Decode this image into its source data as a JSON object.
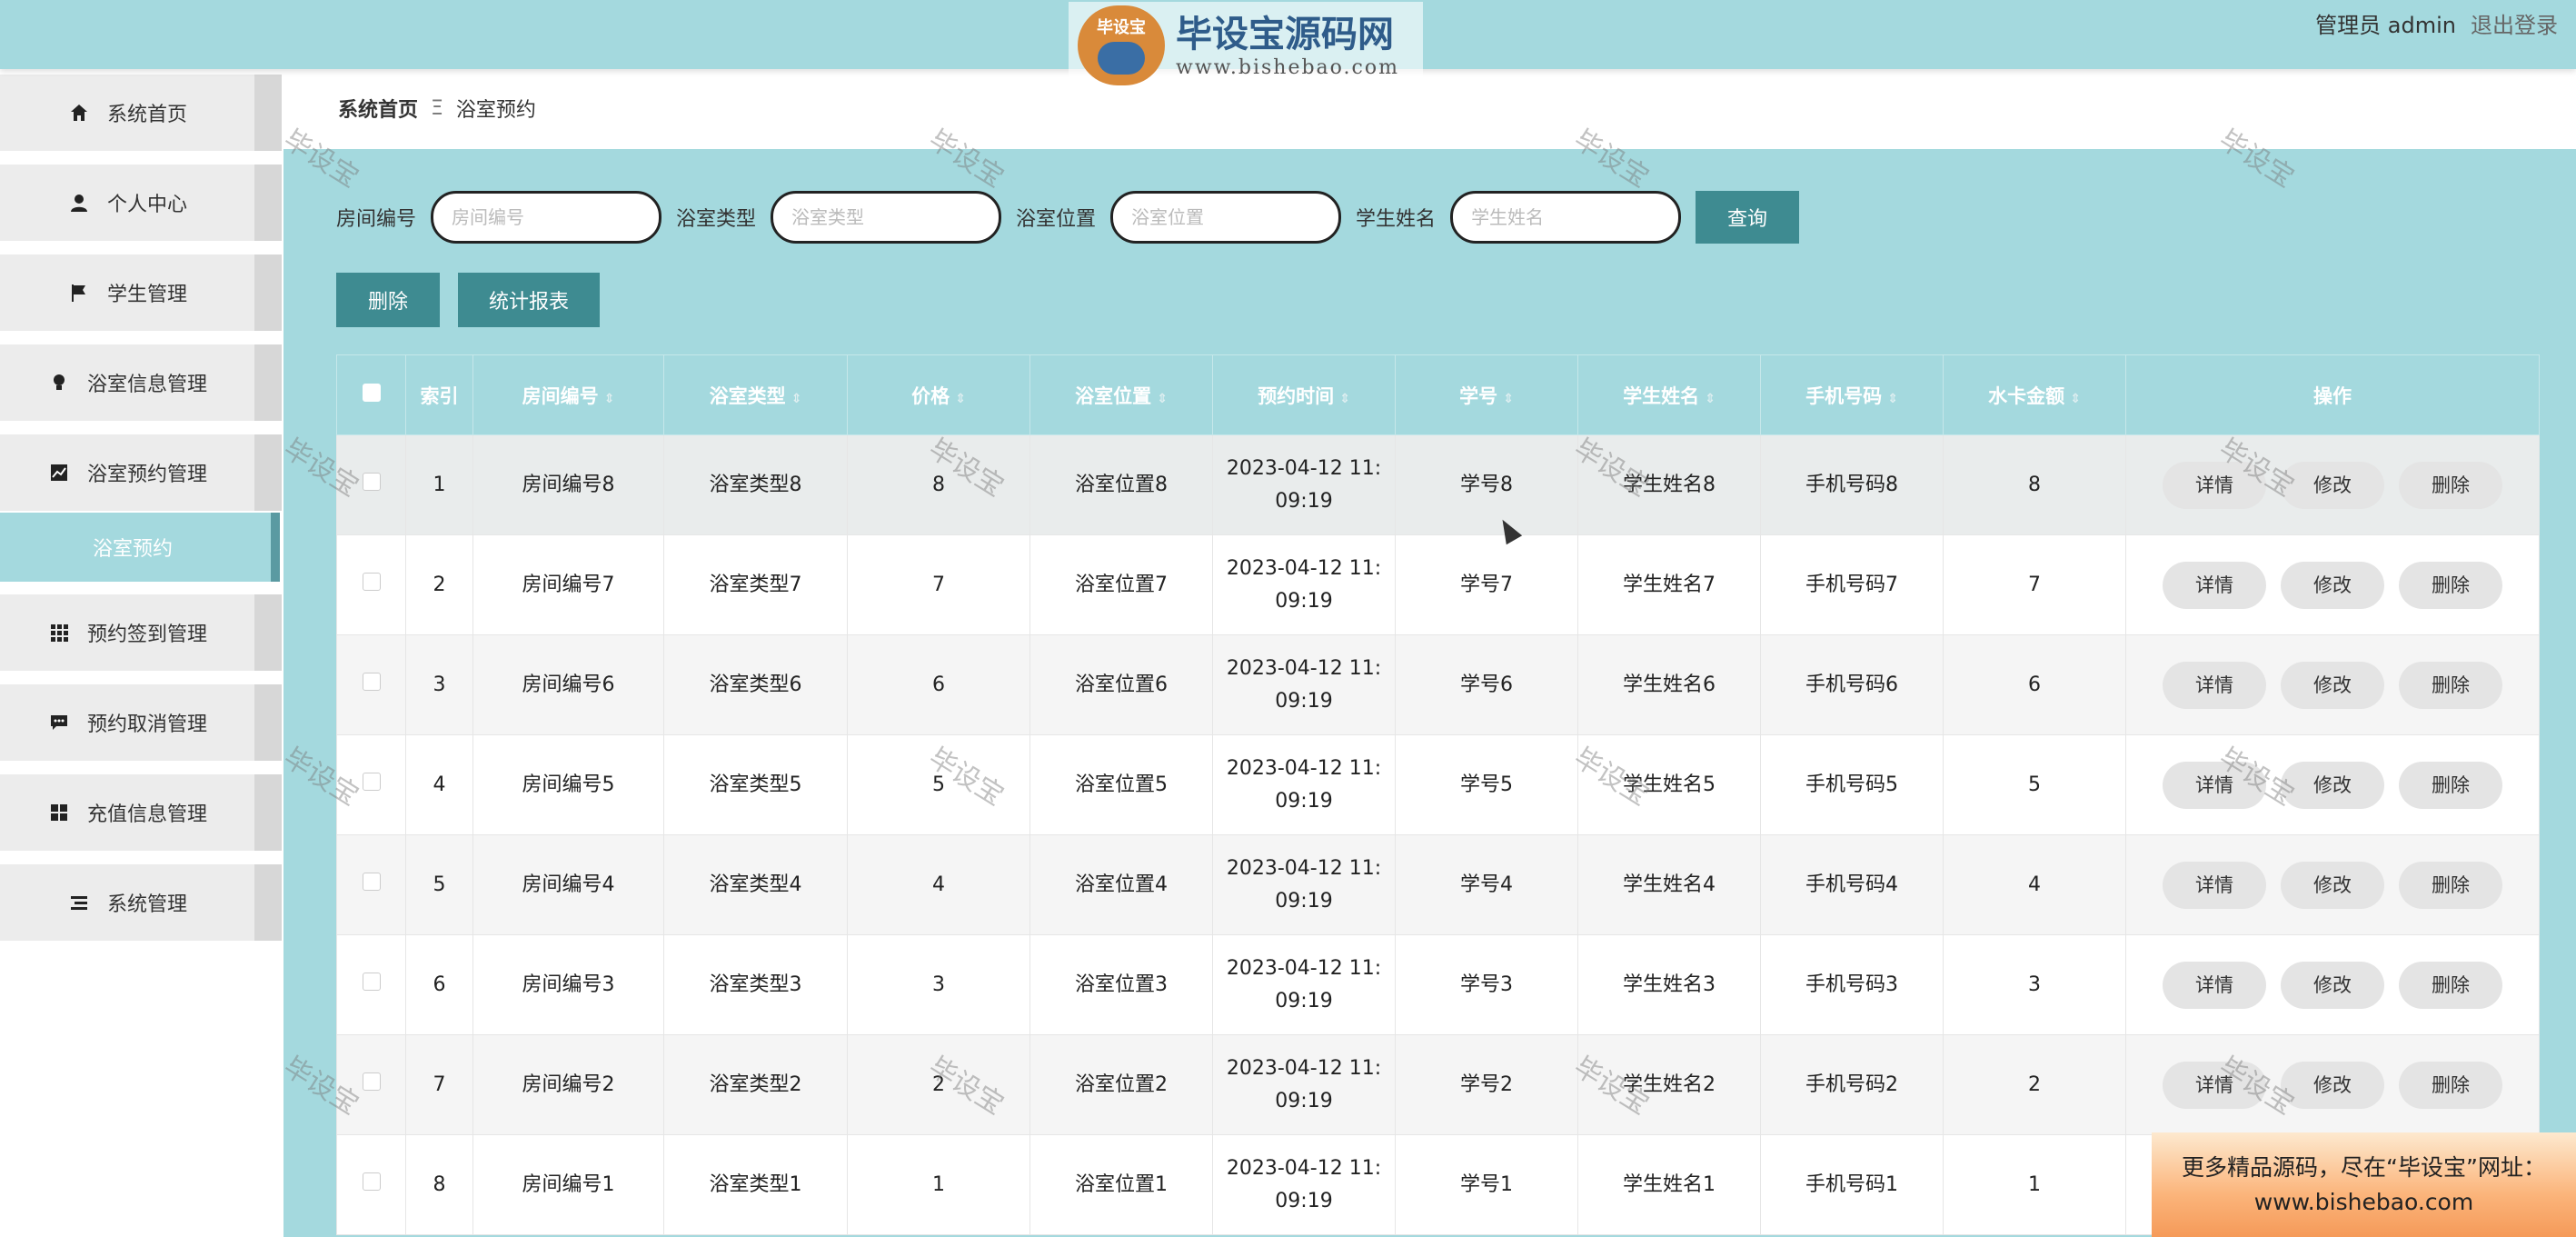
{
  "header": {
    "logo_badge": "毕设宝",
    "logo_main": "毕设宝源码网",
    "logo_sub": "www.bishebao.com",
    "user_label": "管理员 admin",
    "logout": "退出登录"
  },
  "sidebar": {
    "items": [
      {
        "label": "系统首页",
        "icon": "home-icon"
      },
      {
        "label": "个人中心",
        "icon": "user-icon"
      },
      {
        "label": "学生管理",
        "icon": "flag-icon"
      },
      {
        "label": "浴室信息管理",
        "icon": "bulb-icon"
      },
      {
        "label": "浴室预约管理",
        "icon": "chart-icon"
      },
      {
        "label": "预约签到管理",
        "icon": "grid-icon"
      },
      {
        "label": "预约取消管理",
        "icon": "chat-icon"
      },
      {
        "label": "充值信息管理",
        "icon": "apps-icon"
      },
      {
        "label": "系统管理",
        "icon": "list-icon"
      }
    ],
    "active_sub": "浴室预约"
  },
  "breadcrumb": {
    "home": "系统首页",
    "separator": "Ξ",
    "current": "浴室预约"
  },
  "search": {
    "fields": [
      {
        "label": "房间编号",
        "placeholder": "房间编号"
      },
      {
        "label": "浴室类型",
        "placeholder": "浴室类型"
      },
      {
        "label": "浴室位置",
        "placeholder": "浴室位置"
      },
      {
        "label": "学生姓名",
        "placeholder": "学生姓名"
      }
    ],
    "query_button": "查询"
  },
  "actions": {
    "delete": "删除",
    "report": "统计报表"
  },
  "table": {
    "headers": [
      "索引",
      "房间编号",
      "浴室类型",
      "价格",
      "浴室位置",
      "预约时间",
      "学号",
      "学生姓名",
      "手机号码",
      "水卡金额",
      "操作"
    ],
    "row_buttons": [
      "详情",
      "修改",
      "删除"
    ],
    "rows": [
      [
        "1",
        "房间编号8",
        "浴室类型8",
        "8",
        "浴室位置8",
        "2023-04-12 11:09:19",
        "学号8",
        "学生姓名8",
        "手机号码8",
        "8"
      ],
      [
        "2",
        "房间编号7",
        "浴室类型7",
        "7",
        "浴室位置7",
        "2023-04-12 11:09:19",
        "学号7",
        "学生姓名7",
        "手机号码7",
        "7"
      ],
      [
        "3",
        "房间编号6",
        "浴室类型6",
        "6",
        "浴室位置6",
        "2023-04-12 11:09:19",
        "学号6",
        "学生姓名6",
        "手机号码6",
        "6"
      ],
      [
        "4",
        "房间编号5",
        "浴室类型5",
        "5",
        "浴室位置5",
        "2023-04-12 11:09:19",
        "学号5",
        "学生姓名5",
        "手机号码5",
        "5"
      ],
      [
        "5",
        "房间编号4",
        "浴室类型4",
        "4",
        "浴室位置4",
        "2023-04-12 11:09:19",
        "学号4",
        "学生姓名4",
        "手机号码4",
        "4"
      ],
      [
        "6",
        "房间编号3",
        "浴室类型3",
        "3",
        "浴室位置3",
        "2023-04-12 11:09:19",
        "学号3",
        "学生姓名3",
        "手机号码3",
        "3"
      ],
      [
        "7",
        "房间编号2",
        "浴室类型2",
        "2",
        "浴室位置2",
        "2023-04-12 11:09:19",
        "学号2",
        "学生姓名2",
        "手机号码2",
        "2"
      ],
      [
        "8",
        "房间编号1",
        "浴室类型1",
        "1",
        "浴室位置1",
        "2023-04-12 11:09:19",
        "学号1",
        "学生姓名1",
        "手机号码1",
        "1"
      ]
    ]
  },
  "watermark": "毕设宝",
  "ad": {
    "line1": "更多精品源码，尽在“毕设宝”网址：",
    "line2": "www.bishebao.com"
  }
}
